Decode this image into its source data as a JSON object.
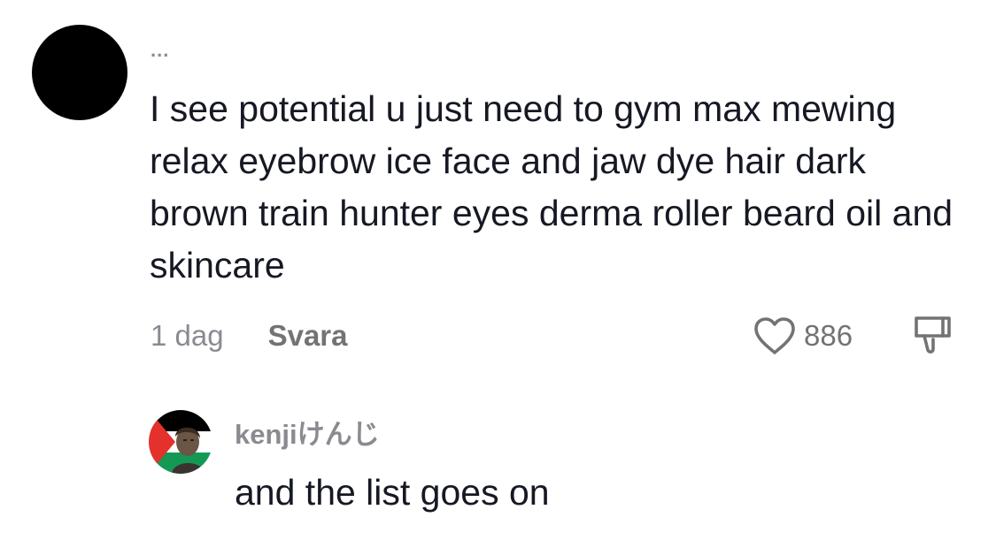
{
  "comment": {
    "username": "...",
    "text": "I see potential u just need to gym max mewing relax eyebrow ice face and jaw dye hair dark brown train hunter eyes derma roller beard oil and skincare",
    "time": "1 dag",
    "reply_label": "Svara",
    "like_count": "886",
    "avatar_color": "#000000"
  },
  "reply": {
    "username": "kenjiけんじ",
    "text": "and the list goes on",
    "avatar_flag_colors": {
      "black": "#000000",
      "white": "#ffffff",
      "green": "#149954",
      "red": "#e4312b"
    }
  },
  "icons": {
    "like": "heart-icon",
    "dislike": "dislike-icon"
  },
  "colors": {
    "text": "#161823",
    "secondary": "#8a8b91",
    "action": "#737373"
  }
}
